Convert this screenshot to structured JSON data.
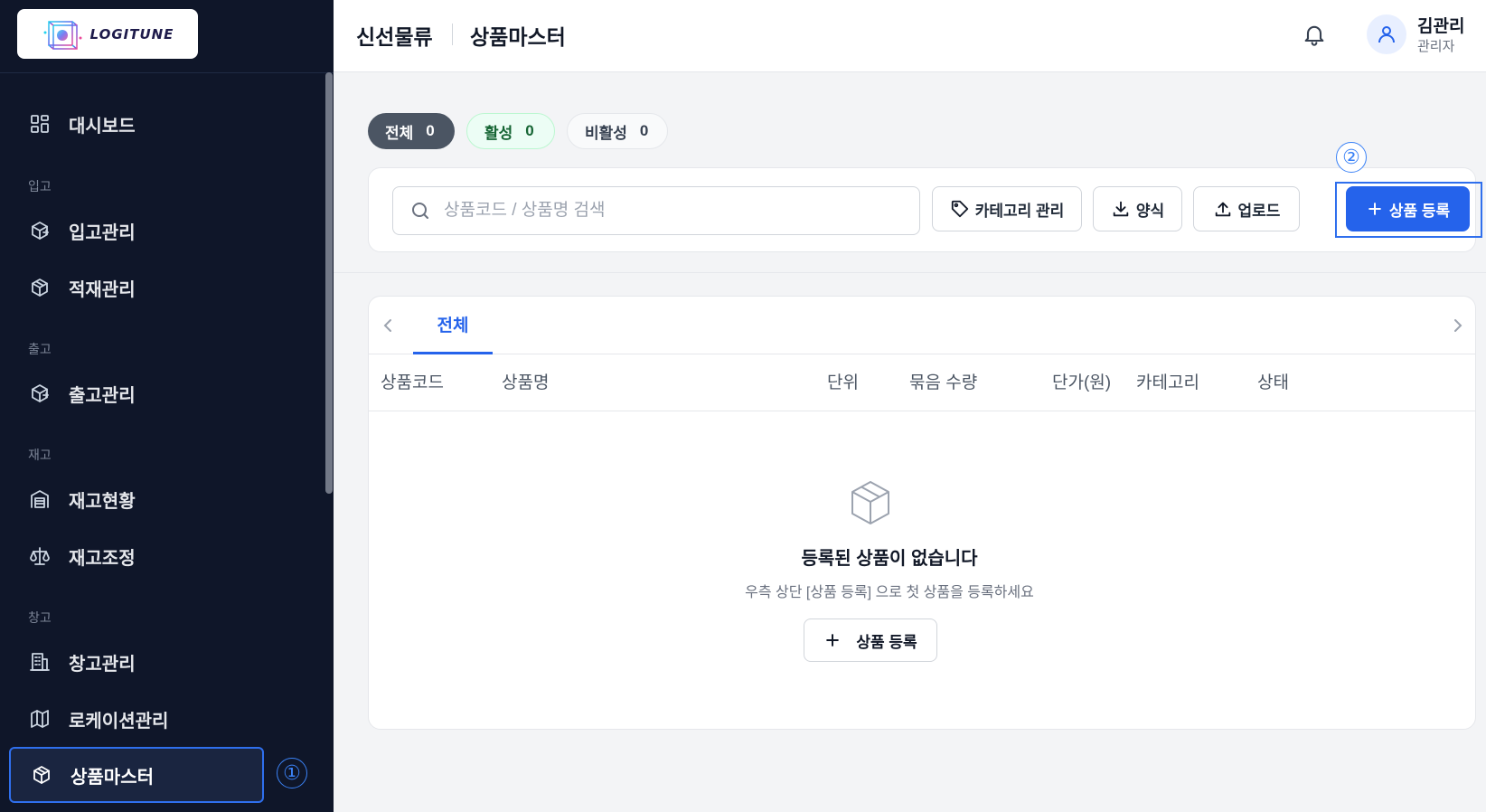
{
  "sidebar": {
    "logo_text": "LOGITUNE",
    "sections": {
      "inbound": "입고",
      "outbound": "출고",
      "inventory": "재고",
      "warehouse": "창고"
    },
    "items": {
      "dashboard": "대시보드",
      "inbound_mgmt": "입고관리",
      "putaway_mgmt": "적재관리",
      "outbound_mgmt": "출고관리",
      "stock_status": "재고현황",
      "stock_adjust": "재고조정",
      "warehouse_mgmt": "창고관리",
      "location_mgmt": "로케이션관리",
      "product_master": "상품마스터"
    },
    "active_item": "상품마스터",
    "marker": "①"
  },
  "header": {
    "breadcrumb_root": "신선물류",
    "page_title": "상품마스터",
    "user_name": "김관리",
    "user_role": "관리자"
  },
  "filters": {
    "all": {
      "label": "전체",
      "count": "0"
    },
    "active": {
      "label": "활성",
      "count": "0"
    },
    "inactive": {
      "label": "비활성",
      "count": "0"
    }
  },
  "toolbar": {
    "search_placeholder": "상품코드 / 상품명 검색",
    "search_value": "",
    "category_label": "카테고리 관리",
    "template_label": "양식",
    "upload_label": "업로드",
    "add_label": "상품 등록",
    "marker": "②"
  },
  "table": {
    "tab_all": "전체",
    "columns": [
      "상품코드",
      "상품명",
      "단위",
      "묶음 수량",
      "단가(원)",
      "카테고리",
      "상태"
    ],
    "rows": [],
    "empty_title": "등록된 상품이 없습니다",
    "empty_subtitle": "우측 상단 [상품 등록] 으로 첫 상품을 등록하세요",
    "empty_button_label": "상품 등록"
  },
  "colors": {
    "sidebar_bg": "#0f1629",
    "accent": "#2563eb",
    "highlight_border": "#2f6fed"
  },
  "icons": {
    "dashboard": "grid-icon",
    "inbound": "box-arrow-icon",
    "putaway": "box-icon",
    "outbound": "box-arrow-icon",
    "stock_status": "warehouse-icon",
    "stock_adjust": "scale-icon",
    "warehouse_mgmt": "building-icon",
    "location": "map-icon",
    "product": "box-icon"
  }
}
